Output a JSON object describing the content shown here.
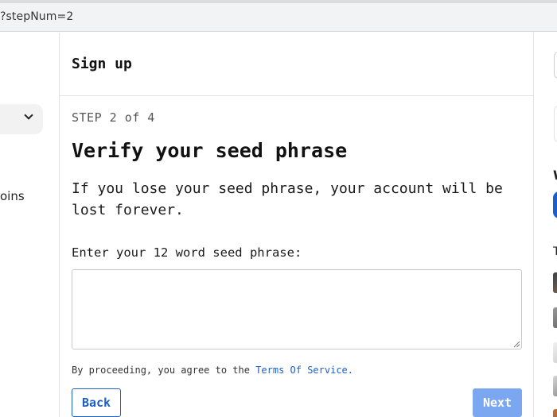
{
  "browser": {
    "url_fragment": "?stepNum=2"
  },
  "left_sidebar": {
    "partial_text": "oins"
  },
  "header": {
    "title": "Sign up"
  },
  "form": {
    "step_label": "STEP 2 of 4",
    "title": "Verify your seed phrase",
    "warning": "If you lose your seed phrase, your account will be lost forever.",
    "field_label": "Enter your 12 word seed phrase:",
    "seed_value": "",
    "seed_placeholder": "",
    "terms_prefix": "By proceeding, you agree to the ",
    "terms_link": "Terms Of Service.",
    "back_label": "Back",
    "next_label": "Next"
  },
  "right_sidebar": {
    "partial_heading_1": "W",
    "partial_heading_2": "T"
  },
  "colors": {
    "accent": "#1c5fc7",
    "next_disabled": "#7ba7f0",
    "border": "#e3e3e3"
  }
}
